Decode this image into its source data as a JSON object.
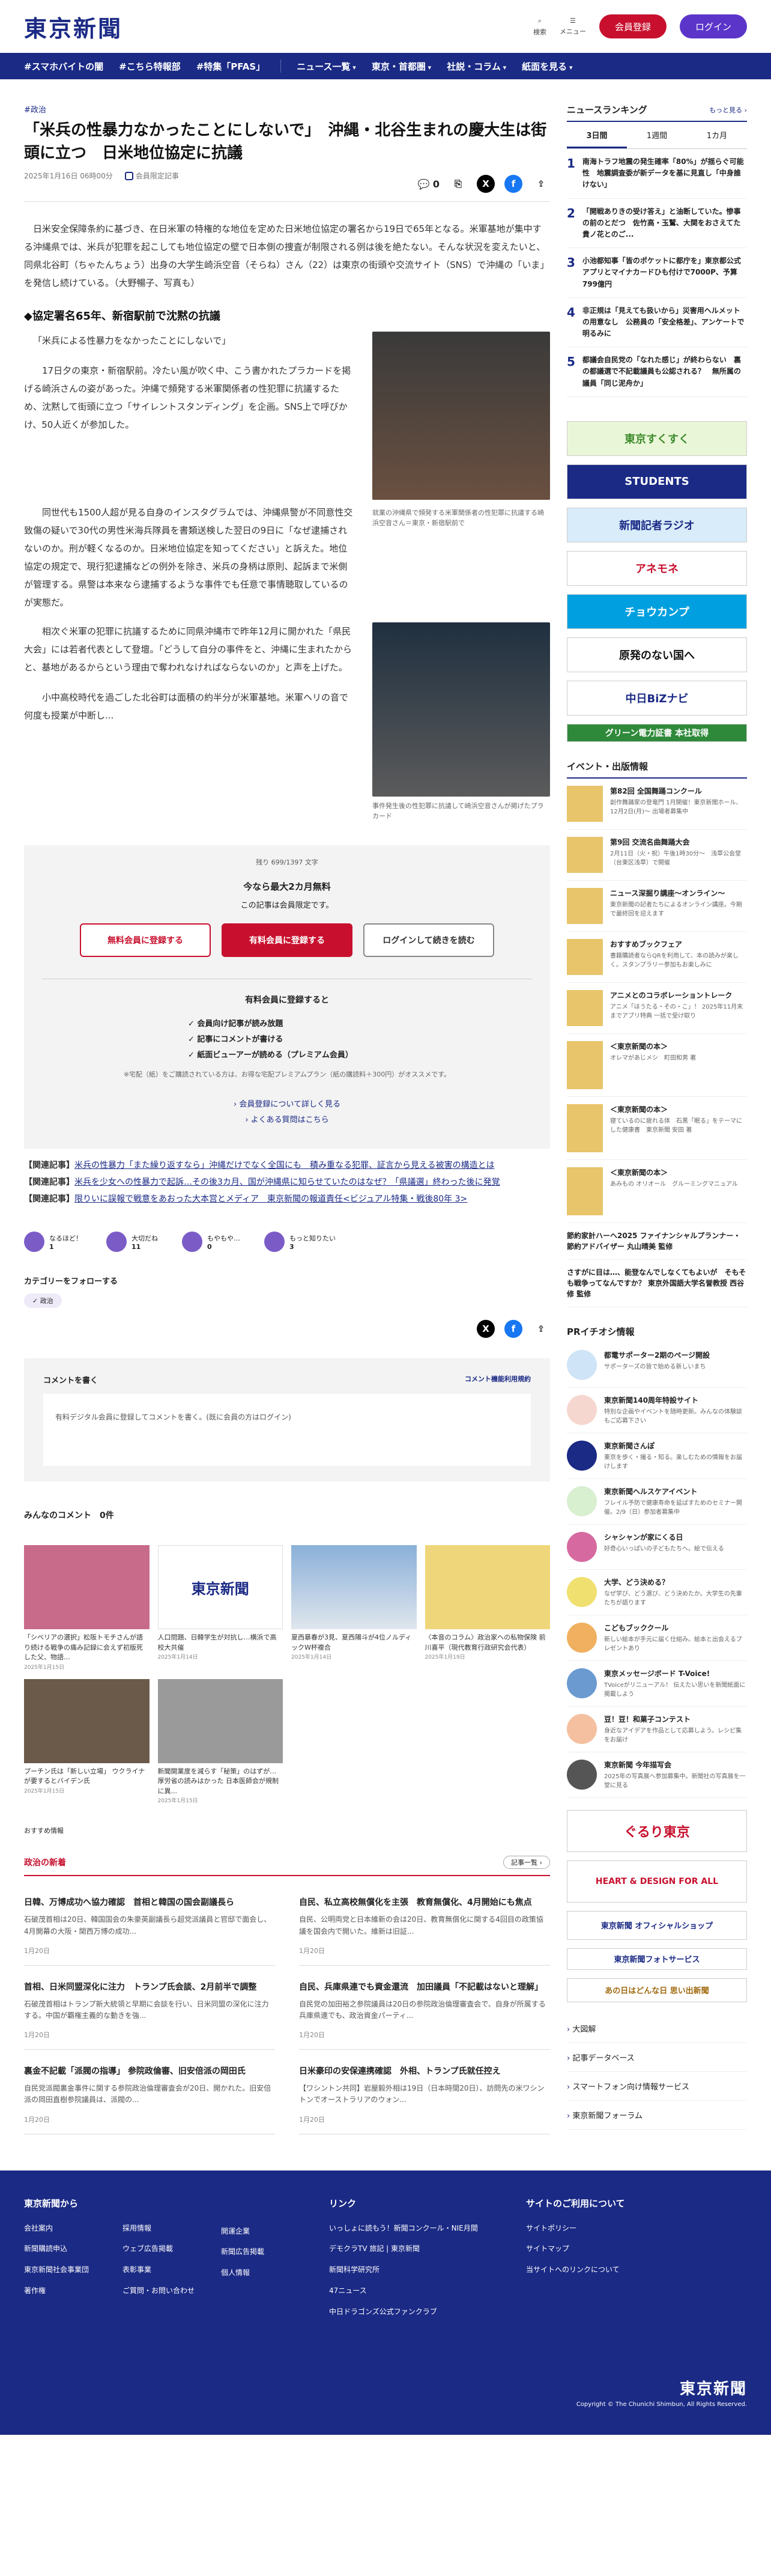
{
  "header": {
    "logo": "東京新聞",
    "search": "検索",
    "menu": "メニュー",
    "register": "会員登録",
    "login": "ログイン"
  },
  "nav": [
    "#スマホバイトの闇",
    "#こちら特報部",
    "#特集「PFAS」",
    "ニュース一覧",
    "東京・首都圏",
    "社説・コラム",
    "紙面を見る"
  ],
  "article": {
    "category": "#政治",
    "title": "「米兵の性暴力なかったことにしないで」　沖縄・北谷生まれの慶大生は街頭に立つ　日米地位協定に抗議",
    "date": "2025年1月16日 06時00分",
    "member_label": "会員限定記事",
    "comment_count": "0",
    "p1": "日米安全保障条約に基づき、在日米軍の特権的な地位を定めた日米地位協定の署名から19日で65年となる。米軍基地が集中する沖縄県では、米兵が犯罪を起こしても地位協定の壁で日本側の捜査が制限される例は後を絶たない。そんな状況を変えたいと、同県北谷町（ちゃたんちょう）出身の大学生崎浜空音（そらね）さん（22）は東京の街頭や交流サイト（SNS）で沖縄の「いま」を発信し続けている。（大野暢子、写真も）",
    "h1": "◆協定署名65年、新宿駅前で沈黙の抗議",
    "p2": "「米兵による性暴力をなかったことにしないで」",
    "p3": "　17日夕の東京・新宿駅前。冷たい風が吹く中、こう書かれたプラカードを掲げる崎浜さんの姿があった。沖縄で頻発する米軍関係者の性犯罪に抗議するため、沈黙して街頭に立つ「サイレントスタンディング」を企画。SNS上で呼びかけ、50人近くが参加した。",
    "p4": "　同世代も1500人超が見る自身のインスタグラムでは、沖縄県警が不同意性交致傷の疑いで30代の男性米海兵隊員を書類送検した翌日の9日に「なぜ逮捕されないのか。刑が軽くなるのか。日米地位協定を知ってください」と訴えた。地位協定の規定で、現行犯逮捕などの例外を除き、米兵の身柄は原則、起訴まで米側が管理する。県警は本来なら逮捕するような事件でも任意で事情聴取しているのが実態だ。",
    "p5": "　相次ぐ米軍の犯罪に抗議するために同県沖縄市で昨年12月に開かれた「県民大会」には若者代表として登壇。「どうして自分の事件をと、沖縄に生まれたからと、基地があるからという理由で奪われなければならないのか」と声を上げた。",
    "p6": "　小中高校時代を過ごした北谷町は面積の約半分が米軍基地。米軍ヘリの音で何度も授業が中断し...",
    "cap1": "就業の沖縄県で頻発する米軍関係者の性犯罪に抗議する崎浜空音さん＝東京・新宿駅前で",
    "cap2": "事件発生後の性犯罪に抗議して崎浜空音さんが掲げたプラカード"
  },
  "paywall": {
    "remaining": "残り 699/1397 文字",
    "headline": "今なら最大2カ月無料",
    "sub": "この記事は会員限定です。",
    "btn_free": "無料会員に登録する",
    "btn_paid": "有料会員に登録する",
    "btn_login": "ログインして続きを読む",
    "benefit_head": "有料会員に登録すると",
    "benefits": [
      "✓ 会員向け記事が読み放題",
      "✓ 記事にコメントが書ける",
      "✓ 紙面ビューアーが読める（プレミアム会員）"
    ],
    "note": "※宅配（紙）をご購読されている方は、お得な宅配プレミアムプラン（紙の購読料＋300円）がオススメです。",
    "link1": "› 会員登録について詳しく見る",
    "link2": "› よくある質問はこちら"
  },
  "related": [
    {
      "label": "【関連記事】",
      "text": "米兵の性暴力「また繰り返すなら」沖縄だけでなく全国にも　積み重なる犯罪、証言から見える被害の構造とは"
    },
    {
      "label": "【関連記事】",
      "text": "米兵を少女への性暴力で起訴…その後3カ月、国が沖縄県に知らせていたのはなぜ？「県議選」終わった後に発覚"
    },
    {
      "label": "【関連記事】",
      "text": "限りいに誤報で戦意をあおった大本営とメディア　東京新聞の報道責任<ビジュアル特集・戦後80年 3>"
    }
  ],
  "reactions": [
    {
      "label": "なるほど！",
      "count": "1"
    },
    {
      "label": "大切だね",
      "count": "11"
    },
    {
      "label": "もやもや…",
      "count": "0"
    },
    {
      "label": "もっと知りたい",
      "count": "3"
    }
  ],
  "follow": {
    "label": "カテゴリーをフォローする",
    "tag": "✓ 政治"
  },
  "comment": {
    "title": "コメントを書く",
    "rule": "コメント機能利用規約",
    "prompt": "有料デジタル会員に登録してコメントを書く。(既に会員の方はログイン)"
  },
  "comment_list": "みんなのコメント　0件",
  "tiles": [
    {
      "title": "「シベリアの選択」松阪トモチさんが語り続ける戦争の痛み記録に会えず初版死した父、物語...",
      "date": "2025年1月15日"
    },
    {
      "title": "人口問題、日韓学生が対抗し…横浜で高校大共催",
      "date": "2025年1月14日"
    },
    {
      "title": "夏西暴春が3見、夏西陽斗が4位ノルディックW杯複合",
      "date": "2025年1月14日"
    },
    {
      "title": "〈本音のコラム〉政治家への私物保険 前川喜平（現代教育行政研究会代表）",
      "date": "2025年1月19日"
    },
    {
      "title": "プーチン氏は「新しい立場」 ウクライナが要するとバイデン氏",
      "date": "2025年1月15日"
    },
    {
      "title": "新聞開業度を減らす「秘策」のはずが… 厚労省の読みはかった 日本医師会が規制に異...",
      "date": "2025年1月15日"
    }
  ],
  "tile_logo": "東京新聞",
  "recommend": "おすすめ情報",
  "politics": {
    "head": "政治の新着",
    "more": "記事一覧 ›",
    "items": [
      {
        "title": "日韓、万博成功へ協力確認　首相と韓国の国会副議長ら",
        "sum": "石破茂首相は20日、韓国国会の朱豪英副議長ら超党派議員と官邸で面会し、4月開幕の大阪・関西万博の成功...",
        "date": "1月20日"
      },
      {
        "title": "自民、私立高校無償化を主張　教育無償化、4月開始にも焦点",
        "sum": "自民、公明両党と日本維新の会は20日、教育無償化に関する4回目の政策協議を国会内で開いた。維新は旧証...",
        "date": "1月20日"
      },
      {
        "title": "首相、日米同盟深化に注力　トランプ氏会談、2月前半で調整",
        "sum": "石破茂首相はトランプ新大統領と早期に会談を行い、日米同盟の深化に注力する。中国が覇権主義的な動きを強...",
        "date": "1月20日"
      },
      {
        "title": "自民、兵庫県連でも資金還流　加田議員「不記載はないと理解」",
        "sum": "自民党の加田裕之参院議員は20日の参院政治倫理審査会で、自身が所属する兵庫県連でも、政治資金パーティ...",
        "date": "1月20日"
      },
      {
        "title": "裏金不記載「派閥の指導」 参院政倫審、旧安倍派の岡田氏",
        "sum": "自民党派閥裏金事件に関する参院政治倫理審査会が20日、開かれた。旧安倍派の岡田直樹参院議員は、派閥の...",
        "date": "1月20日"
      },
      {
        "title": "日米豪印の安保連携確認　外相、トランプ氏就任控え",
        "sum": "【ワシントン共同】岩屋毅外相は19日（日本時間20日）、訪問先の米ワシントンでオーストラリアのウォン...",
        "date": "1月20日"
      }
    ]
  },
  "side": {
    "ranking_head": "ニュースランキング",
    "ranking_more": "もっと見る ›",
    "tabs": [
      "3日間",
      "1週間",
      "1カ月"
    ],
    "ranks": [
      {
        "n": "1",
        "t": "南海トラフ地震の発生確率「80%」が揺らぐ可能性　地震調査委が新データを基に見直し「中身誰けない」"
      },
      {
        "n": "2",
        "t": "「開戦ありきの受け答え」と油断していた。惨事の前のとだつ　佐竹高・玉鷲、大関をおさえてた貴ノ花とのご..."
      },
      {
        "n": "3",
        "t": "小池都知事「皆のポケットに都庁を」東京都公式アプリとマイナカードひも付けで7000P、予算799億円"
      },
      {
        "n": "4",
        "t": "非正規は「見えても扱いから」災害用ヘルメットの用意なし　公務員の「安全格差」、アンケートで明るみに"
      },
      {
        "n": "5",
        "t": "都議会自民党の「なれた感じ」が終わらない　裏の都議選で不記載議員も公認される？　無所属の議員「同じ泥舟か」"
      }
    ],
    "banners": [
      "東京すくすく",
      "STUDENTS",
      "新聞記者ラジオ",
      "アネモネ",
      "チョウカンプ",
      "原発のない国へ",
      "中日BiZナビ",
      "グリーン電力証書 本社取得"
    ],
    "events_head": "イベント・出版情報",
    "events": [
      {
        "t": "第82回 全国舞踊コンクール",
        "s": "創作舞踊家の登竜門 1月開催！東京新聞ホール、12月2日(月)〜 出場者募集中"
      },
      {
        "t": "第9回 交流名曲舞踊大会",
        "s": "2月11日（火・祝）午後1時30分〜　浅草公会堂（台東区浅草）で開催"
      },
      {
        "t": "ニュース深掘り講座〜オンライン〜",
        "s": "東京新聞の記者たちによるオンライン講座。今期で最終回を迎えます"
      },
      {
        "t": "おすすめブックフェア",
        "s": "書籍購読者ならQRを利用して、本の読みが楽しく。スタンプラリー参加もお楽しみに"
      },
      {
        "t": "アニメとのコラボレーショントレーク",
        "s": "アニメ「ほうたる・その・こ」！ 2025年11月末までアプリ特典 一括で受け取り"
      },
      {
        "t": "＜東京新聞の本＞",
        "s": "オレマがあじメシ　町田和男 著"
      },
      {
        "t": "＜東京新聞の本＞",
        "s": "寝ているのに疲れる体　石黒「眠る」をテーマにした健康書　東京新聞 安田 著"
      },
      {
        "t": "＜東京新聞の本＞",
        "s": "あみもの オリオール　グルーミングマニュアル"
      }
    ],
    "ad_text": [
      "節約家計ハーヘ2025 ファイナンシャルプランナー・節約アドバイザー 丸山晴美 監修",
      "さすがに目は…、能登なんでしなくてもよいが　そもそも戦争ってなんですか？ 東京外国語大学名誉教授 西谷修 監修"
    ],
    "pr_head": "PRイチオシ情報",
    "pr": [
      {
        "t": "都電サポーター2期のページ開設",
        "s": "サポーターズの皆で始める新しいまち"
      },
      {
        "t": "東京新聞140周年特設サイト",
        "s": "特別な企画やイベントを随時更新。みんなの体験談もご応募下さい"
      },
      {
        "t": "東京新聞さんぽ",
        "s": "東京を歩く・撮る・知る。楽しむための情報をお届けします"
      },
      {
        "t": "東京新聞ヘルスケアイベント",
        "s": "フレイル予防で健康寿命を延ばすためのセミナー開催。2/9（日）参加者募集中"
      },
      {
        "t": "シャシャンが家にくる日",
        "s": "好奇心いっぱいの子どもたちへ。絵で伝える"
      },
      {
        "t": "大学、どう決める？",
        "s": "なぜ学び、どう選び、どう決めたか。大学生の先輩たちが語ります"
      },
      {
        "t": "こどもブッククール",
        "s": "新しい絵本が手元に届く仕組み。絵本と出会えるプレゼントあり"
      },
      {
        "t": "東京メッセージボード T-Voice!",
        "s": "TVoiceがリニューアル！ 伝えたい思いを新聞紙面に掲載しよう"
      },
      {
        "t": "豆！豆！和菓子コンテスト",
        "s": "身近なアイデアを作品として応募しよう。レシピ集をお届け"
      },
      {
        "t": "東京新聞 今年描写会",
        "s": "2025年の写真展へ参加募集中。新聞社の写真展を一堂に見る"
      }
    ],
    "banners2": [
      "ぐるり東京",
      "HEART & DESIGN FOR ALL",
      "東京新聞 オフィシャルショップ",
      "東京新聞フォトサービス",
      "あの日はどんな日 思い出新聞"
    ],
    "menu": [
      "大図解",
      "記事データベース",
      "スマートフォン向け情報サービス",
      "東京新聞フォーラム"
    ]
  },
  "footer": {
    "col1_head": "東京新聞から",
    "col1": [
      "会社案内",
      "採用情報",
      "新聞購読申込",
      "ウェブ広告掲載",
      "東京新聞社会事業団",
      "表彰事業",
      "著作権",
      "ご質問・お問い合わせ",
      "",
      "開運企業",
      "新聞広告掲載",
      "個人情報"
    ],
    "col2_head": "リンク",
    "col2": [
      "いっしょに読もう！新聞コンクール・NIE月間",
      "デモクラTV 旅記 | 東京新聞",
      "新聞科学研究所",
      "47ニュース",
      "中日ドラゴンズ公式ファンクラブ"
    ],
    "col3_head": "サイトのご利用について",
    "col3": [
      "サイトポリシー",
      "サイトマップ",
      "当サイトへのリンクについて"
    ],
    "logo": "東京新聞",
    "copy": "Copyright © The Chunichi Shimbun, All Rights Reserved."
  },
  "colors": {
    "navy": "#1b2a85",
    "red": "#c8102e",
    "purple": "#5b35c9"
  }
}
